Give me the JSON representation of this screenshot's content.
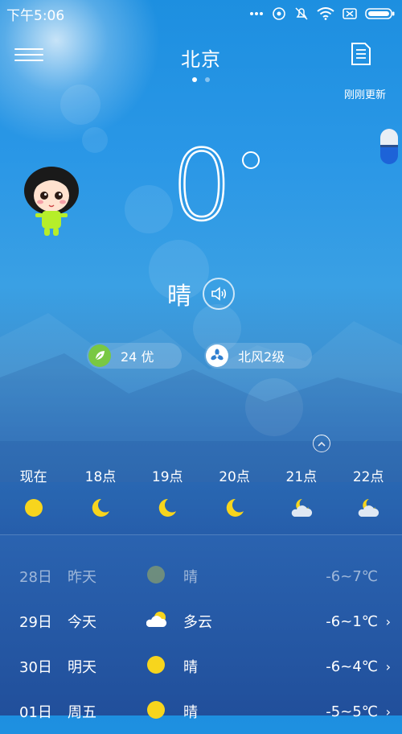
{
  "status": {
    "time": "下午5:06"
  },
  "header": {
    "city": "北京",
    "updated": "刚刚更新"
  },
  "current": {
    "temp": "0",
    "condition": "晴",
    "aqi": "24 优",
    "wind": "北风2级"
  },
  "hourly": [
    {
      "label": "现在",
      "icon": "sun-icon"
    },
    {
      "label": "18点",
      "icon": "moon-icon"
    },
    {
      "label": "19点",
      "icon": "moon-icon"
    },
    {
      "label": "20点",
      "icon": "moon-icon"
    },
    {
      "label": "21点",
      "icon": "moon-cloud-icon"
    },
    {
      "label": "22点",
      "icon": "moon-cloud-icon"
    }
  ],
  "daily": [
    {
      "date": "28日",
      "weekday": "昨天",
      "icon": "sun-icon",
      "condition": "晴",
      "range": "-6~7℃"
    },
    {
      "date": "29日",
      "weekday": "今天",
      "icon": "partly-cloudy-icon",
      "condition": "多云",
      "range": "-6~1℃"
    },
    {
      "date": "30日",
      "weekday": "明天",
      "icon": "sun-icon",
      "condition": "晴",
      "range": "-6~4℃"
    },
    {
      "date": "01日",
      "weekday": "周五",
      "icon": "sun-icon",
      "condition": "晴",
      "range": "-5~5℃"
    }
  ],
  "colors": {
    "sun": "#f7d51d",
    "aqi_good": "#79c843",
    "past_sun": "#a6b35a"
  }
}
